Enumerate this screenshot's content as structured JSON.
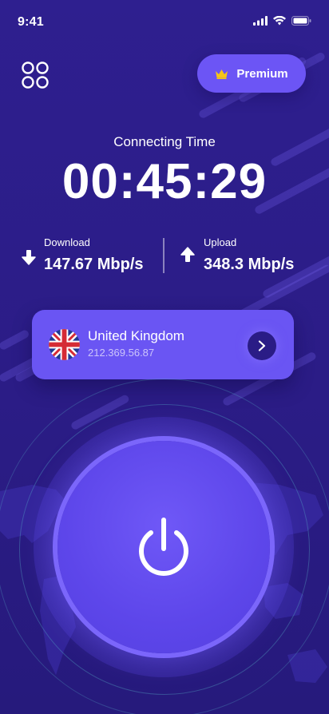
{
  "status_bar": {
    "time": "9:41"
  },
  "header": {
    "premium_label": "Premium"
  },
  "connection": {
    "title": "Connecting Time",
    "elapsed": "00:45:29"
  },
  "stats": {
    "download": {
      "label": "Download",
      "value": "147.67 Mbp/s"
    },
    "upload": {
      "label": "Upload",
      "value": "348.3 Mbp/s"
    }
  },
  "server": {
    "country": "United Kingdom",
    "ip": "212.369.56.87"
  },
  "colors": {
    "background": "#2e1f8f",
    "accent": "#6c55f5",
    "card": "#6a55f3",
    "crown": "#f5c518"
  },
  "icons": {
    "menu": "grid-circles-icon",
    "premium": "crown-icon",
    "download": "download-arrow-icon",
    "upload": "upload-arrow-icon",
    "flag": "uk-flag-icon",
    "chevron": "chevron-right-icon",
    "power": "power-icon"
  }
}
